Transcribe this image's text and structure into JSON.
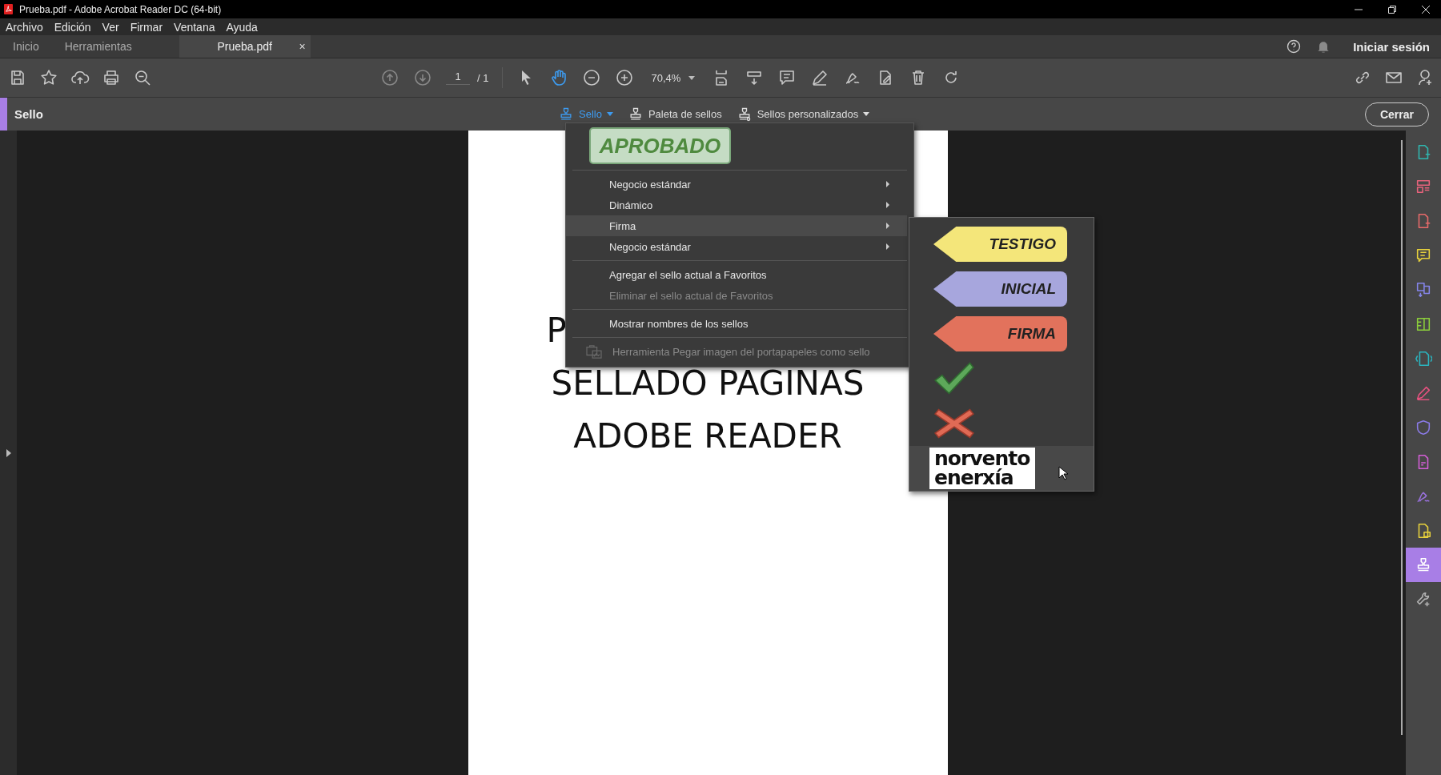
{
  "window": {
    "title": "Prueba.pdf - Adobe Acrobat Reader DC (64-bit)"
  },
  "menu_bar": [
    "Archivo",
    "Edición",
    "Ver",
    "Firmar",
    "Ventana",
    "Ayuda"
  ],
  "tabs": [
    {
      "label": "Inicio",
      "selected": false
    },
    {
      "label": "Herramientas",
      "selected": false
    },
    {
      "label": "Prueba.pdf",
      "selected": true,
      "close": "×"
    }
  ],
  "account": {
    "sign_in": "Iniciar sesión"
  },
  "toolbar": {
    "page_current": "1",
    "page_total": "/ 1",
    "zoom": "70,4%",
    "hand_selected": true
  },
  "tool_bar": {
    "title": "Sello",
    "stamp_button": {
      "label": "Sello",
      "expanded": true
    },
    "palette": "Paleta de sellos",
    "custom": "Sellos personalizados",
    "close": "Cerrar"
  },
  "stamp_menu": {
    "preview": "APROBADO",
    "items": [
      {
        "kind": "submenu",
        "label": "Negocio estándar",
        "selected": false
      },
      {
        "kind": "submenu",
        "label": "Dinámico",
        "selected": false
      },
      {
        "kind": "submenu",
        "label": "Firma",
        "selected": true
      },
      {
        "kind": "submenu",
        "label": "Negocio estándar",
        "selected": false
      },
      {
        "kind": "separator"
      },
      {
        "kind": "action",
        "label": "Agregar el sello actual a Favoritos",
        "disabled": false
      },
      {
        "kind": "action",
        "label": "Eliminar el sello actual de Favoritos",
        "disabled": true
      },
      {
        "kind": "separator"
      },
      {
        "kind": "action",
        "label": "Mostrar nombres de los sellos",
        "disabled": false
      },
      {
        "kind": "separator"
      },
      {
        "kind": "tool",
        "label": "Herramienta Pegar imagen del portapapeles como sello",
        "disabled": true
      }
    ]
  },
  "stamp_submenu": [
    {
      "kind": "tag",
      "label": "TESTIGO",
      "color": "#f4e67a",
      "selected": false
    },
    {
      "kind": "tag",
      "label": "INICIAL",
      "color": "#a7a6dd",
      "selected": false
    },
    {
      "kind": "tag",
      "label": "FIRMA",
      "color": "#e2725c",
      "selected": false
    },
    {
      "kind": "check",
      "selected": false
    },
    {
      "kind": "cross",
      "selected": false
    },
    {
      "kind": "logo",
      "lines": [
        "norvento",
        "enerxía"
      ],
      "selected": true
    }
  ],
  "document": {
    "lines": [
      "P",
      "SELLADO PAGINAS",
      "ADOBE READER"
    ]
  },
  "sidebar_tools": [
    {
      "color": "#2fb7b0",
      "selected": false
    },
    {
      "color": "#e8637c",
      "selected": false
    },
    {
      "color": "#e86a6a",
      "selected": false
    },
    {
      "color": "#e8d23c",
      "selected": false
    },
    {
      "color": "#8585ea",
      "selected": false
    },
    {
      "color": "#8ccf3b",
      "selected": false
    },
    {
      "color": "#2bb5c0",
      "selected": false
    },
    {
      "color": "#e5527f",
      "selected": false
    },
    {
      "color": "#8b7be8",
      "selected": false
    },
    {
      "color": "#d55ed8",
      "selected": false
    },
    {
      "color": "#9b72e0",
      "selected": false
    },
    {
      "color": "#e8d23c",
      "selected": false
    },
    {
      "color": "#ffffff",
      "selected": true
    },
    {
      "color": "#b5b5b5",
      "selected": false
    }
  ]
}
